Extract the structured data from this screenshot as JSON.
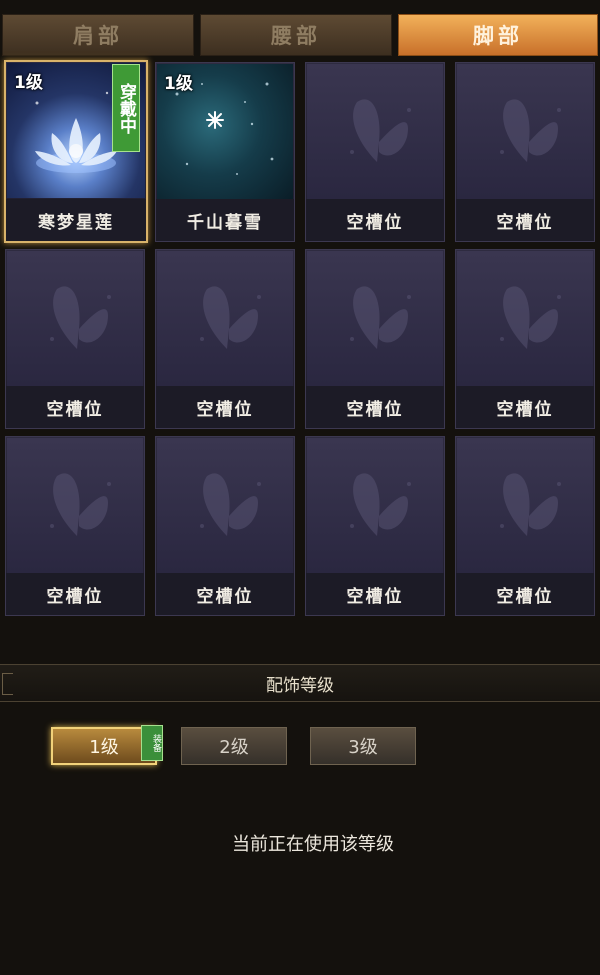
{
  "tabs": [
    {
      "label": "肩部",
      "active": false
    },
    {
      "label": "腰部",
      "active": false
    },
    {
      "label": "脚部",
      "active": true
    }
  ],
  "slots": [
    {
      "level": "1级",
      "name": "寒梦星莲",
      "worn_tag": "穿戴中",
      "art": "lotus"
    },
    {
      "level": "1级",
      "name": "千山暮雪",
      "art": "snow"
    },
    {
      "name": "空槽位",
      "art": "empty"
    },
    {
      "name": "空槽位",
      "art": "empty"
    },
    {
      "name": "空槽位",
      "art": "empty"
    },
    {
      "name": "空槽位",
      "art": "empty"
    },
    {
      "name": "空槽位",
      "art": "empty"
    },
    {
      "name": "空槽位",
      "art": "empty"
    },
    {
      "name": "空槽位",
      "art": "empty"
    },
    {
      "name": "空槽位",
      "art": "empty"
    },
    {
      "name": "空槽位",
      "art": "empty"
    },
    {
      "name": "空槽位",
      "art": "empty"
    }
  ],
  "accessory_level": {
    "title": "配饰等级",
    "levels": [
      {
        "label": "1级",
        "active": true,
        "badge": "装备"
      },
      {
        "label": "2级",
        "active": false
      },
      {
        "label": "3级",
        "active": false
      }
    ],
    "status": "当前正在使用该等级"
  },
  "colors": {
    "active_tab": "#e89a45",
    "worn_tag": "#3f9a36",
    "selected_border": "#d9b36a"
  }
}
